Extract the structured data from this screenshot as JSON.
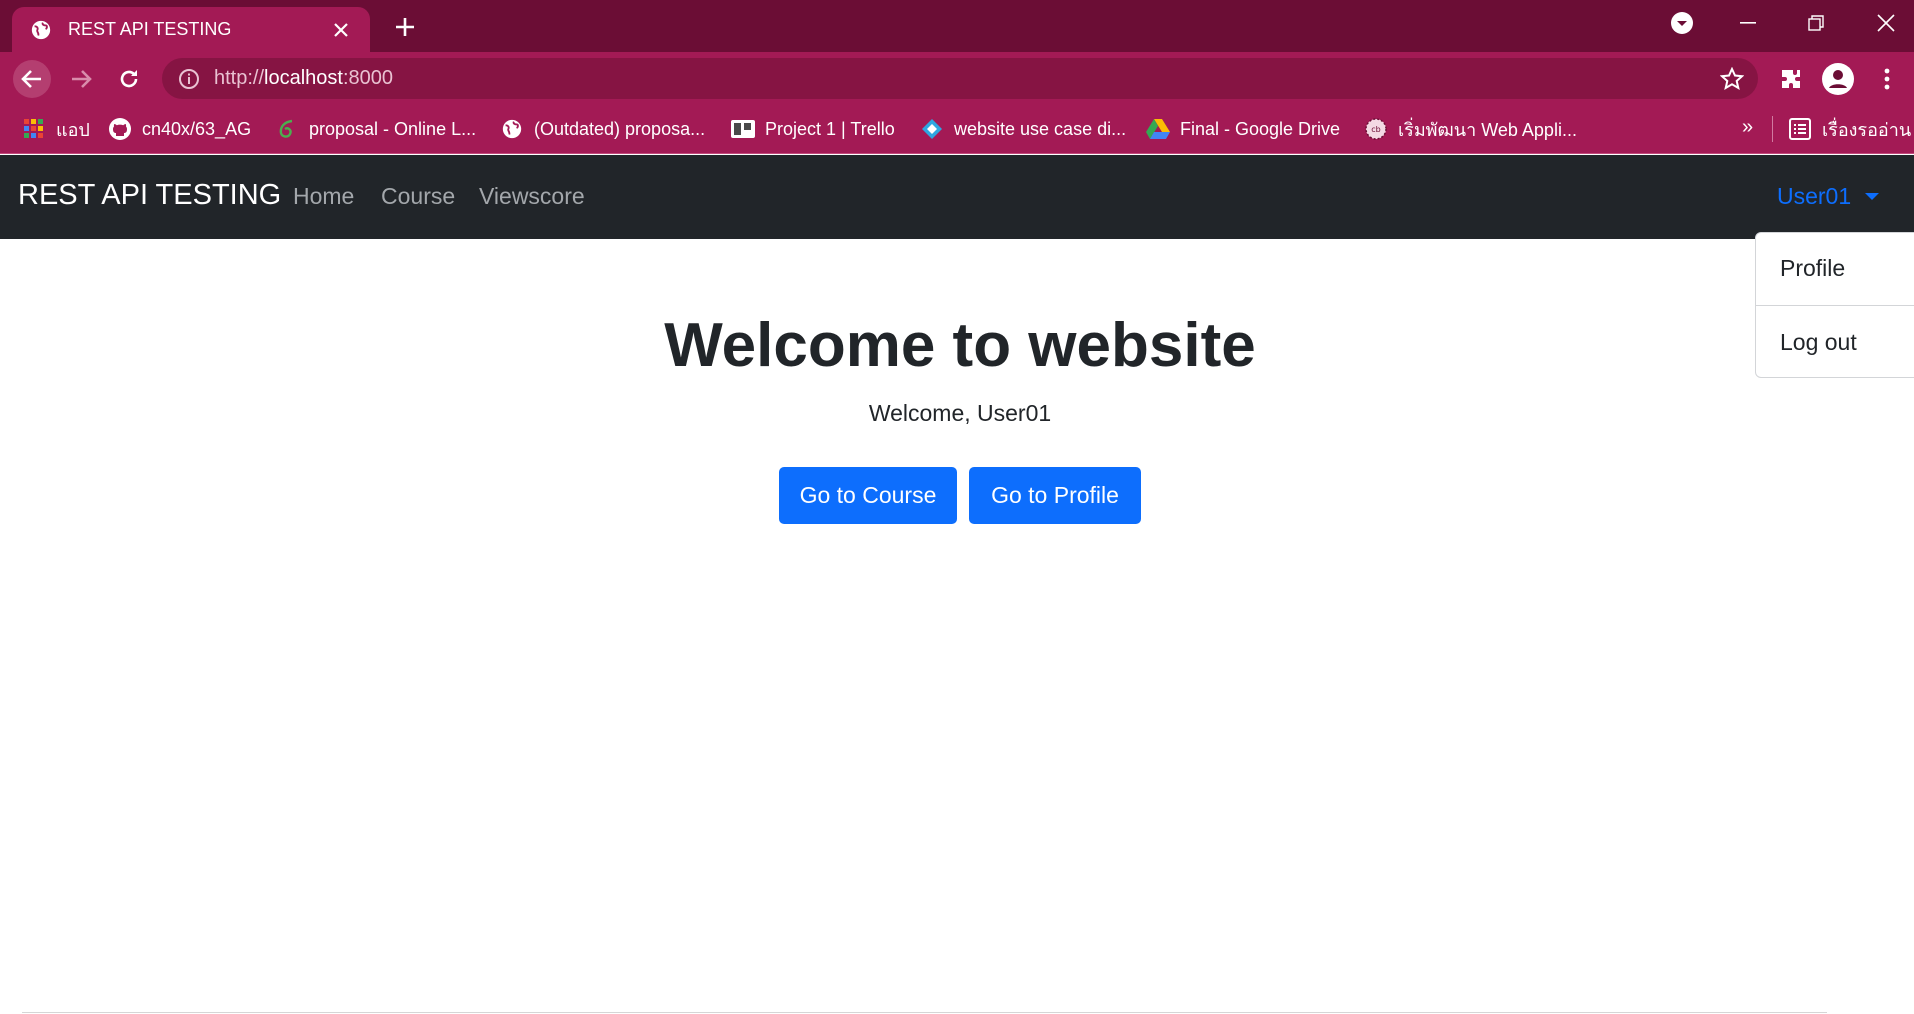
{
  "browser": {
    "tab_title": "REST API TESTING",
    "url_scheme": "http://",
    "url_host": "localhost",
    "url_port": ":8000",
    "bookmarks": [
      {
        "label": "แอป",
        "icon": "apps-grid-icon"
      },
      {
        "label": "cn40x/63_AG",
        "icon": "github-icon"
      },
      {
        "label": "proposal - Online L...",
        "icon": "overleaf-icon"
      },
      {
        "label": "(Outdated) proposa...",
        "icon": "globe-icon"
      },
      {
        "label": "Project 1 | Trello",
        "icon": "trello-icon"
      },
      {
        "label": "website use case di...",
        "icon": "diagram-icon"
      },
      {
        "label": "Final - Google Drive",
        "icon": "google-drive-icon"
      },
      {
        "label": "เริ่มพัฒนา Web Appli...",
        "icon": "site-icon"
      }
    ],
    "bookmarks_more": "»",
    "reading_list": "เรื่องรออ่าน",
    "colors": {
      "tabstrip": "#6b0d35",
      "toolbar": "#a31a55",
      "omnibox": "#861443"
    }
  },
  "navbar": {
    "brand": "REST API TESTING",
    "links": [
      "Home",
      "Course",
      "Viewscore"
    ],
    "user": "User01",
    "dropdown": {
      "items": [
        "Profile",
        "Log out"
      ]
    }
  },
  "main": {
    "title": "Welcome to website",
    "subtitle": "Welcome, User01",
    "buttons": [
      "Go to Course",
      "Go to Profile"
    ]
  },
  "colors": {
    "navbar_bg": "#212529",
    "primary": "#0d6efd",
    "text": "#212529"
  }
}
